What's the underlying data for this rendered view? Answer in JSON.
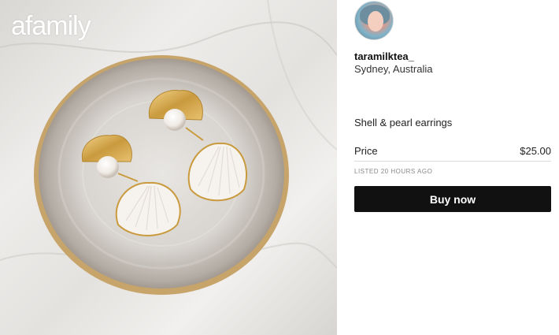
{
  "watermark": {
    "text": "afamily"
  },
  "seller": {
    "username": "taramilktea_",
    "location": "Sydney, Australia"
  },
  "product": {
    "title": "Shell & pearl earrings",
    "price_label": "Price",
    "price_value": "$25.00",
    "listed": "LISTED 20 HOURS AGO",
    "buy_label": "Buy now"
  },
  "colors": {
    "buy_button": "#111111",
    "divider": "#dcdcdc",
    "muted_text": "#888888"
  }
}
